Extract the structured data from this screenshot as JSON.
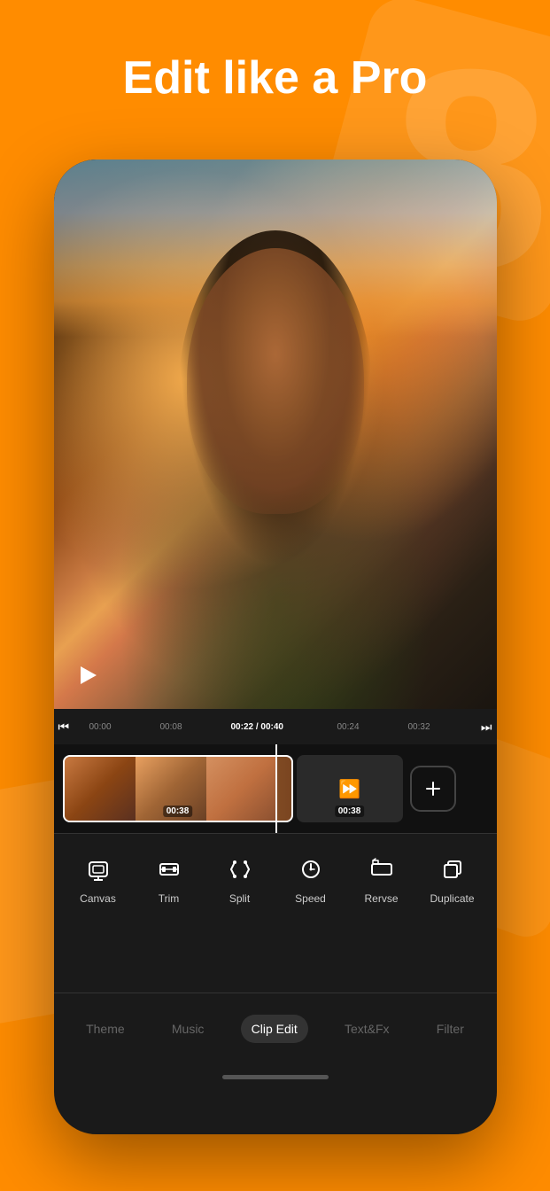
{
  "headline": {
    "text": "Edit like a Pro"
  },
  "timeline": {
    "current_time": "00:22",
    "total_time": "00:40",
    "marks": [
      "00:00",
      "00:08",
      "00:22 / 00:40",
      "00:24",
      "00:32"
    ]
  },
  "clips": [
    {
      "duration": "00:38",
      "type": "video"
    },
    {
      "duration": "00:38",
      "type": "transition"
    }
  ],
  "toolbar": {
    "tools": [
      {
        "id": "canvas",
        "label": "Canvas"
      },
      {
        "id": "trim",
        "label": "Trim"
      },
      {
        "id": "split",
        "label": "Split"
      },
      {
        "id": "speed",
        "label": "Speed"
      },
      {
        "id": "reverse",
        "label": "Rervse"
      },
      {
        "id": "duplicate",
        "label": "Duplicate"
      }
    ]
  },
  "bottom_nav": {
    "items": [
      {
        "id": "theme",
        "label": "Theme",
        "active": false
      },
      {
        "id": "music",
        "label": "Music",
        "active": false
      },
      {
        "id": "clip_edit",
        "label": "Clip Edit",
        "active": true
      },
      {
        "id": "text_fx",
        "label": "Text&Fx",
        "active": false
      },
      {
        "id": "filter",
        "label": "Filter",
        "active": false
      }
    ]
  }
}
